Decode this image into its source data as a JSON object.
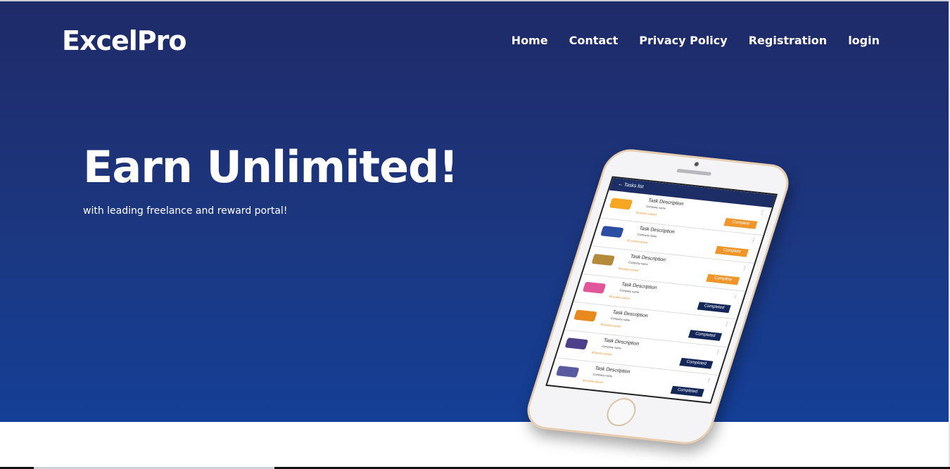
{
  "brand": {
    "name": "ExcelPro"
  },
  "nav": {
    "items": [
      {
        "label": "Home"
      },
      {
        "label": "Contact"
      },
      {
        "label": "Privacy Policy"
      },
      {
        "label": "Registration"
      },
      {
        "label": "login"
      }
    ]
  },
  "hero": {
    "headline": "Earn Unlimited!",
    "subline": "with leading freelance and reward portal!"
  },
  "phone": {
    "screen_title": "Tasks list",
    "tasks": [
      {
        "desc": "Task Description",
        "company": "Company name",
        "points": "90 points earned",
        "status": "Complete",
        "status_color": "#f0952a",
        "logo_color": "#f5a623"
      },
      {
        "desc": "Task Description",
        "company": "Company name",
        "points": "90 points earned",
        "status": "Complete",
        "status_color": "#f0952a",
        "logo_color": "#2a4ea2"
      },
      {
        "desc": "Task Description",
        "company": "Company name",
        "points": "90 points earned",
        "status": "Complete",
        "status_color": "#f0952a",
        "logo_color": "#b38b3a"
      },
      {
        "desc": "Task Description",
        "company": "Company name",
        "points": "90 points earned",
        "status": "Completed",
        "status_color": "#14275b",
        "logo_color": "#e0569a"
      },
      {
        "desc": "Task Description",
        "company": "Company name",
        "points": "90 points earned",
        "status": "Completed",
        "status_color": "#14275b",
        "logo_color": "#e8891d"
      },
      {
        "desc": "Task Description",
        "company": "Company name",
        "points": "90 points earned",
        "status": "Completed",
        "status_color": "#14275b",
        "logo_color": "#4d3f8a"
      },
      {
        "desc": "Task Description",
        "company": "Company name",
        "points": "90 points earned",
        "status": "Completed",
        "status_color": "#14275b",
        "logo_color": "#5a5aa0"
      }
    ]
  }
}
